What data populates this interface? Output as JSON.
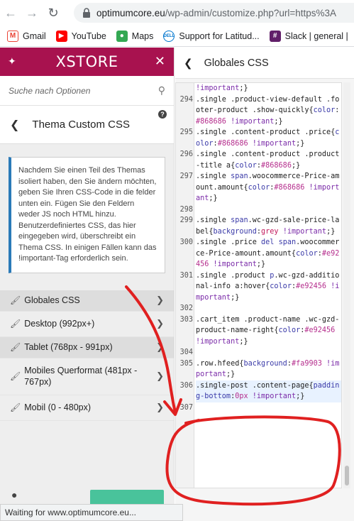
{
  "browser": {
    "url_host": "optimumcore.eu",
    "url_path": "/wp-admin/customize.php?url=https%3A",
    "bookmarks": [
      {
        "label": "Gmail",
        "icon": "gmail-icon",
        "color": "#ea4335"
      },
      {
        "label": "YouTube",
        "icon": "youtube-icon",
        "color": "#ff0000"
      },
      {
        "label": "Maps",
        "icon": "maps-icon",
        "color": "#34a853"
      },
      {
        "label": "Support for Latitud...",
        "icon": "dell-icon",
        "color": "#0076ce"
      },
      {
        "label": "Slack | general |",
        "icon": "slack-icon",
        "color": "#611f69"
      }
    ],
    "status_text": "Waiting for www.optimumcore.eu..."
  },
  "customizer": {
    "brand": "XSTORE",
    "brand_color": "#a8124f",
    "search_placeholder": "Suche nach Optionen",
    "section_title": "Thema Custom CSS",
    "description": "Nachdem Sie einen Teil des Themas isoliert haben, den Sie ändern möchten, geben Sie Ihren CSS-Code in die felder unten ein. Fügen Sie den Feldern weder JS noch HTML hinzu. Benutzerdefiniertes CSS, das hier eingegeben wird, überschreibt ein Thema CSS. In einigen Fällen kann das !important-Tag erforderlich sein.",
    "menu": [
      {
        "label": "Globales CSS"
      },
      {
        "label": "Desktop (992px+)"
      },
      {
        "label": "Tablet (768px - 991px)"
      },
      {
        "label": "Mobiles Querformat (481px - 767px)"
      },
      {
        "label": "Mobil (0 - 480px)"
      }
    ]
  },
  "panel": {
    "title": "Globales CSS",
    "lines": [
      {
        "n": "",
        "html": "<span class=\"imp\">!important</span>;}"
      },
      {
        "n": "294",
        "html": ".single .product-view-default .footer-product .show-quickly{<span class=\"kw\">color</span>:<span class=\"col\">#868686</span> <span class=\"imp\">!important</span>;}"
      },
      {
        "n": "295",
        "html": ".single .content-product .price{<span class=\"kw\">color</span>:<span class=\"col\">#868686</span> <span class=\"imp\">!important</span>;}"
      },
      {
        "n": "296",
        "html": ".single .content-product .product-title a{<span class=\"kw\">color</span>:<span class=\"col\">#868686</span>;}"
      },
      {
        "n": "297",
        "html": ".single <span class=\"kw\">span</span>.woocommerce-Price-amount.amount{<span class=\"kw\">color</span>:<span class=\"col\">#868686</span> <span class=\"imp\">!important</span>;}"
      },
      {
        "n": "298",
        "html": " "
      },
      {
        "n": "299",
        "html": ".single <span class=\"kw\">span</span>.wc-gzd-sale-price-label{<span class=\"kw\">background</span>:<span class=\"grey\">grey</span> <span class=\"imp\">!important</span>;}"
      },
      {
        "n": "300",
        "html": ".single .price <span class=\"kw\">del</span> <span class=\"kw\">span</span>.woocommerce-Price-amount.amount{<span class=\"kw\">color</span>:<span class=\"col\">#e92456</span> <span class=\"imp\">!important</span>;}"
      },
      {
        "n": "301",
        "html": ".single .product <span class=\"kw\">p</span>.wc-gzd-additional-info a:hover{<span class=\"kw\">color</span>:<span class=\"col\">#e92456</span> <span class=\"imp\">!important</span>;}"
      },
      {
        "n": "302",
        "html": " "
      },
      {
        "n": "303",
        "html": ".cart_item .product-name .wc-gzd-product-name-right{<span class=\"kw\">color</span>:<span class=\"col\">#e92456</span> <span class=\"imp\">!important</span>;}"
      },
      {
        "n": "304",
        "html": " "
      },
      {
        "n": "305",
        "html": ".row.hfeed{<span class=\"kw\">background</span>:<span class=\"col\">#fa9903</span> <span class=\"imp\">!important</span>;}"
      },
      {
        "n": "306",
        "html": ".single-post .content-page{<span class=\"kw\">padding-bottom</span>:<span class=\"col\">0px</span> <span class=\"imp\">!important</span>;}",
        "active": true
      },
      {
        "n": "307",
        "html": " "
      }
    ]
  }
}
